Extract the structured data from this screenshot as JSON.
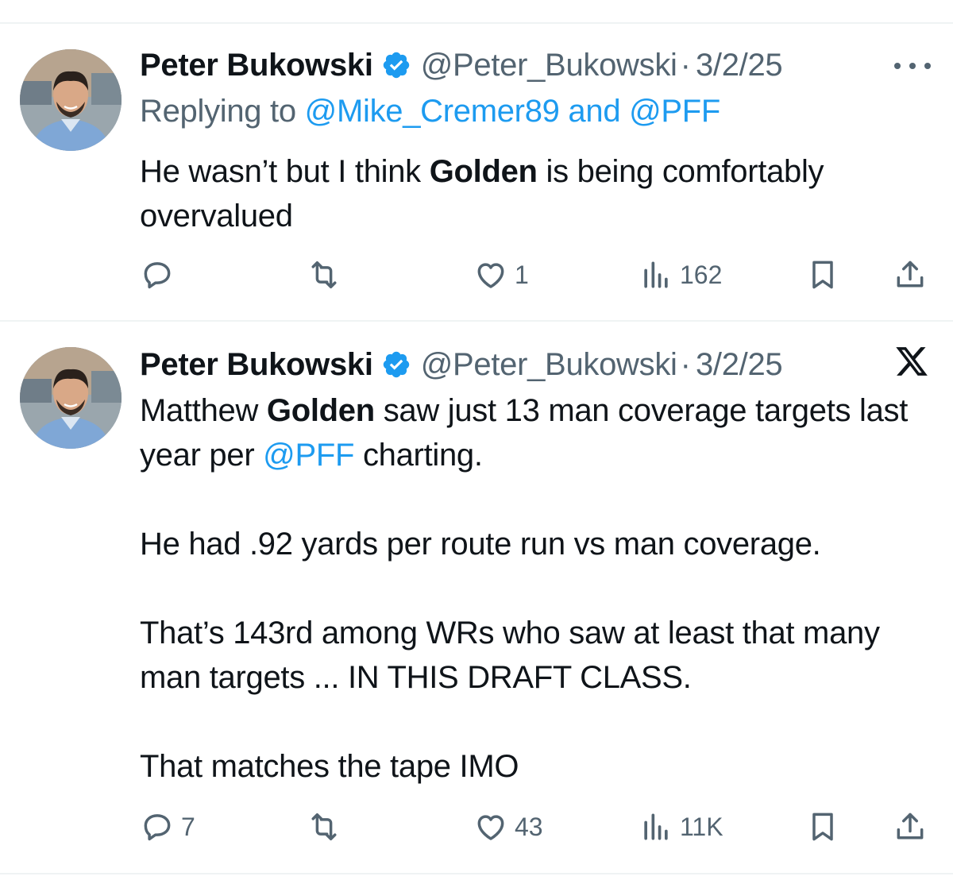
{
  "tweets": [
    {
      "author_name": "Peter Bukowski",
      "handle": "@Peter_Bukowski",
      "separator": "·",
      "date": "3/2/25",
      "replying_label": "Replying to",
      "reply_mention_1": "@Mike_Cremer89",
      "reply_and": "and",
      "reply_mention_2": "@PFF",
      "text_1": "He wasn’t but I think",
      "text_bold": "Golden",
      "text_2": "is being comfortably overvalued",
      "reply_count": "",
      "retweet_count": "",
      "like_count": "1",
      "view_count": "162"
    },
    {
      "author_name": "Peter Bukowski",
      "handle": "@Peter_Bukowski",
      "separator": "·",
      "date": "3/2/25",
      "p1_a": "Matthew",
      "p1_bold": "Golden",
      "p1_b": "saw just 13 man coverage targets last year per",
      "p1_mention": "@PFF",
      "p1_c": "charting.",
      "p2": "He had .92 yards per route run vs man coverage.",
      "p3": "That’s 143rd among WRs who saw at least that many man targets ... IN THIS DRAFT CLASS.",
      "p4": "That matches the tape IMO",
      "reply_count": "7",
      "retweet_count": "",
      "like_count": "43",
      "view_count": "11K"
    }
  ],
  "icons": {
    "verified": "verified-badge-icon",
    "more": "more-options-icon",
    "x_logo": "x-logo-icon",
    "reply": "reply-icon",
    "retweet": "retweet-icon",
    "like": "heart-icon",
    "views": "views-icon",
    "bookmark": "bookmark-icon",
    "share": "share-icon"
  },
  "colors": {
    "link": "#1d9bf0",
    "secondary_text": "#536471",
    "primary_text": "#0f1419",
    "divider": "#eff3f4"
  }
}
